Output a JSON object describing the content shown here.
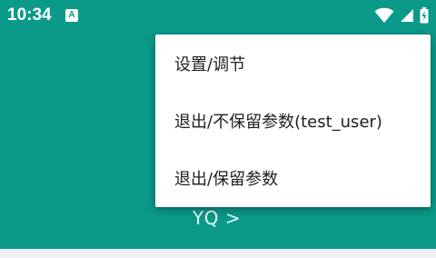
{
  "status_bar": {
    "time": "10:34",
    "notification_icon": "A",
    "icons": [
      "wifi-icon",
      "signal-icon",
      "battery-charging-icon"
    ]
  },
  "background_color": "#0b9a8a",
  "content": {
    "user_label": "YQ >"
  },
  "menu": {
    "items": [
      {
        "label": "设置/调节"
      },
      {
        "label": "退出/不保留参数(test_user)"
      },
      {
        "label": "退出/保留参数"
      }
    ]
  }
}
